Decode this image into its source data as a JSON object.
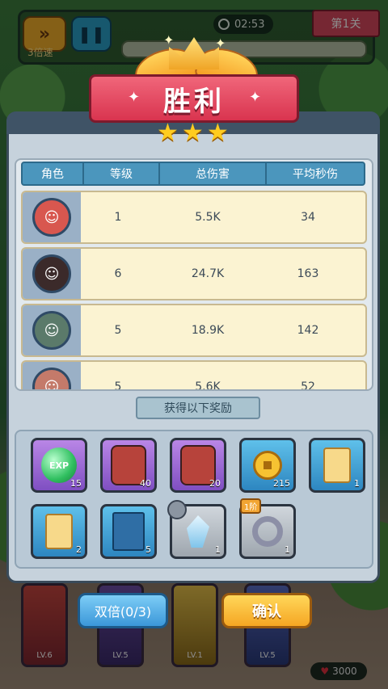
{
  "hud": {
    "speed_label": "3倍速",
    "timer": "02:53",
    "level": "第1关"
  },
  "victory": {
    "title": "胜利",
    "stars": 3
  },
  "stats": {
    "headers": [
      "角色",
      "等级",
      "总伤害",
      "平均秒伤"
    ],
    "rows": [
      {
        "level": "1",
        "damage": "5.5K",
        "dps": "34"
      },
      {
        "level": "6",
        "damage": "24.7K",
        "dps": "163"
      },
      {
        "level": "5",
        "damage": "18.9K",
        "dps": "142"
      },
      {
        "level": "5",
        "damage": "5.6K",
        "dps": "52"
      }
    ]
  },
  "rewards": {
    "title": "获得以下奖励",
    "items": [
      {
        "icon": "exp-orb-icon",
        "label": "EXP",
        "count": "15"
      },
      {
        "icon": "hero-shard-icon",
        "count": "40"
      },
      {
        "icon": "hero-shard-icon",
        "count": "20"
      },
      {
        "icon": "coin-icon",
        "count": "215"
      },
      {
        "icon": "scroll-icon",
        "count": "1"
      },
      {
        "icon": "scroll-icon",
        "count": "2"
      },
      {
        "icon": "book-icon",
        "count": "5"
      },
      {
        "icon": "crystal-icon",
        "count": "1"
      },
      {
        "icon": "ring-icon",
        "tier": "1阶",
        "count": "1"
      }
    ]
  },
  "buttons": {
    "double": "双倍(0/3)",
    "confirm": "确认"
  },
  "bottom": {
    "cards": [
      {
        "lv": "LV.6"
      },
      {
        "lv": "LV.5"
      },
      {
        "lv": "LV.1"
      },
      {
        "lv": "LV.5"
      }
    ],
    "gold": "3000"
  }
}
